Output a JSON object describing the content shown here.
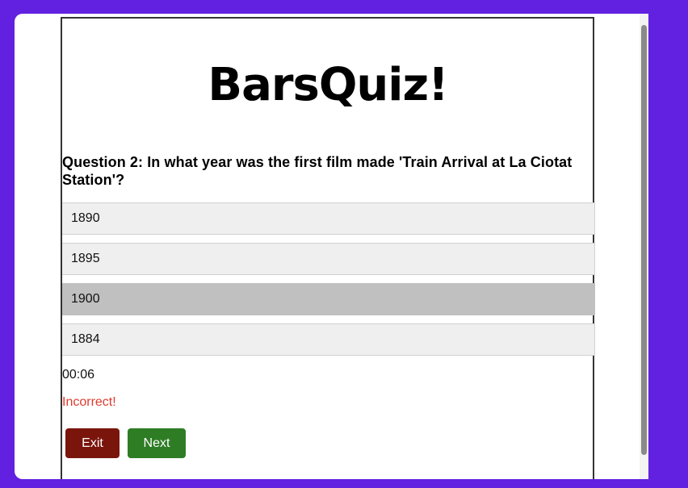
{
  "logo": {
    "text": "BarsQuiz!"
  },
  "question": {
    "text": "Question 2: In what year was the first film made 'Train Arrival at La Ciotat Station'?"
  },
  "answers": [
    {
      "label": "1890",
      "selected": false
    },
    {
      "label": "1895",
      "selected": false
    },
    {
      "label": "1900",
      "selected": true
    },
    {
      "label": "1884",
      "selected": false
    }
  ],
  "timer": {
    "value": "00:06"
  },
  "feedback": {
    "text": "Incorrect!",
    "color": "#e03a2e"
  },
  "buttons": {
    "exit_label": "Exit",
    "exit_color": "#7a150c",
    "next_label": "Next",
    "next_color": "#2e7d25"
  },
  "colors": {
    "background": "#6220e0",
    "answer_bg": "#efefef",
    "answer_selected_bg": "#c0c0c0"
  }
}
